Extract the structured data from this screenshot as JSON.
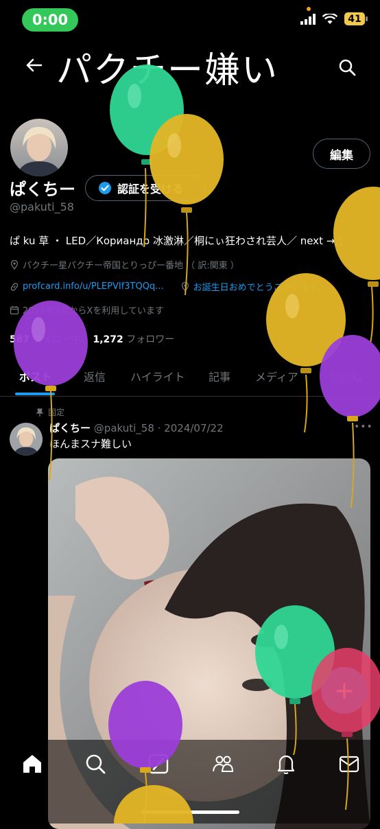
{
  "status": {
    "time": "0:00",
    "battery": "41"
  },
  "header": {
    "title": "パクチー嫌い"
  },
  "profile": {
    "edit_label": "編集",
    "display_name": "ぱくちー",
    "verify_label": "認証を受ける",
    "handle": "@pakuti_58",
    "bio": "ぱ ku 草 ・ LED／Кориандр 冰激淋／桐にぃ狂わされ芸人／ next →△",
    "location": "パクチー星パクチー帝国とりっぴー番地 （ 訳:関東 ）",
    "website": "profcard.info/u/PLEPVIf3TQQq...",
    "birthday": "お誕生日おめでとうございます。",
    "joined": "2022年2月からXを利用しています",
    "following_count": "587",
    "following_label": "フォロー中",
    "followers_count": "1,272",
    "followers_label": "フォロワー"
  },
  "tabs": [
    {
      "label": "ポスト"
    },
    {
      "label": "返信"
    },
    {
      "label": "ハイライト"
    },
    {
      "label": "記事"
    },
    {
      "label": "メディア"
    },
    {
      "label": "いいね"
    }
  ],
  "post": {
    "pinned_label": "固定",
    "name": "ぱくちー",
    "handle_date": "@pakuti_58 · 2024/07/22",
    "text": "ほんまスナ難しい",
    "more": "•••"
  },
  "fab_label": "+",
  "nav": [
    "home-icon",
    "search-icon",
    "grok-icon",
    "communities-icon",
    "notifications-icon",
    "messages-icon"
  ],
  "colors": {
    "accent": "#1d9bf0",
    "status_green": "#34c759"
  }
}
